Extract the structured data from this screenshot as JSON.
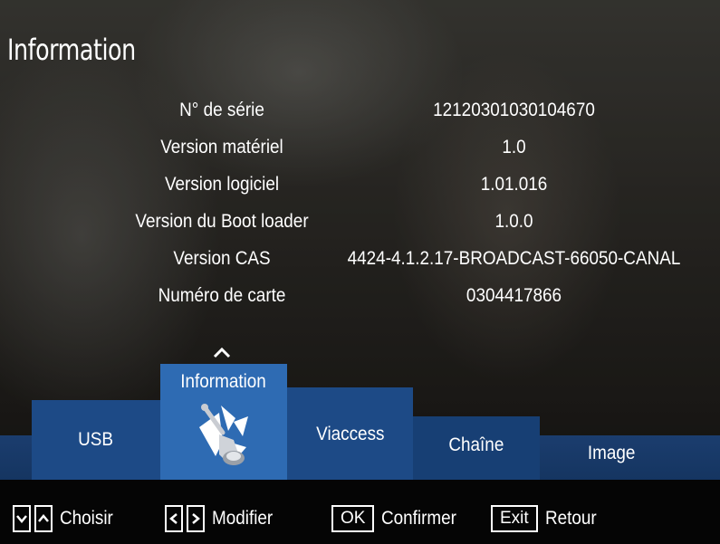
{
  "page_title": "Information",
  "info_rows": [
    {
      "label": "N° de série",
      "value": "12120301030104670"
    },
    {
      "label": "Version matériel",
      "value": "1.0"
    },
    {
      "label": "Version logiciel",
      "value": "1.01.016"
    },
    {
      "label": "Version du Boot loader",
      "value": "1.0.0"
    },
    {
      "label": "Version CAS",
      "value": "4424-4.1.2.17-BROADCAST-66050-CANAL"
    },
    {
      "label": "Numéro de carte",
      "value": "0304417866"
    }
  ],
  "menu": {
    "tabs": [
      {
        "label": "USB"
      },
      {
        "label": "Information",
        "selected": true,
        "icon": "satellite-dish-icon"
      },
      {
        "label": "Viaccess"
      },
      {
        "label": "Chaîne"
      },
      {
        "label": "Image"
      }
    ]
  },
  "footer": {
    "choose": {
      "keys": [
        "V",
        "Λ"
      ],
      "label": "Choisir"
    },
    "modify": {
      "keys": [
        "<",
        ">"
      ],
      "label": "Modifier"
    },
    "confirm": {
      "key": "OK",
      "label": "Confirmer"
    },
    "back": {
      "key": "Exit",
      "label": "Retour"
    }
  },
  "colors": {
    "tab_selected": "#2e6bb3",
    "tab_normal": "#1d4a86",
    "tab_bar": "#173f74"
  }
}
